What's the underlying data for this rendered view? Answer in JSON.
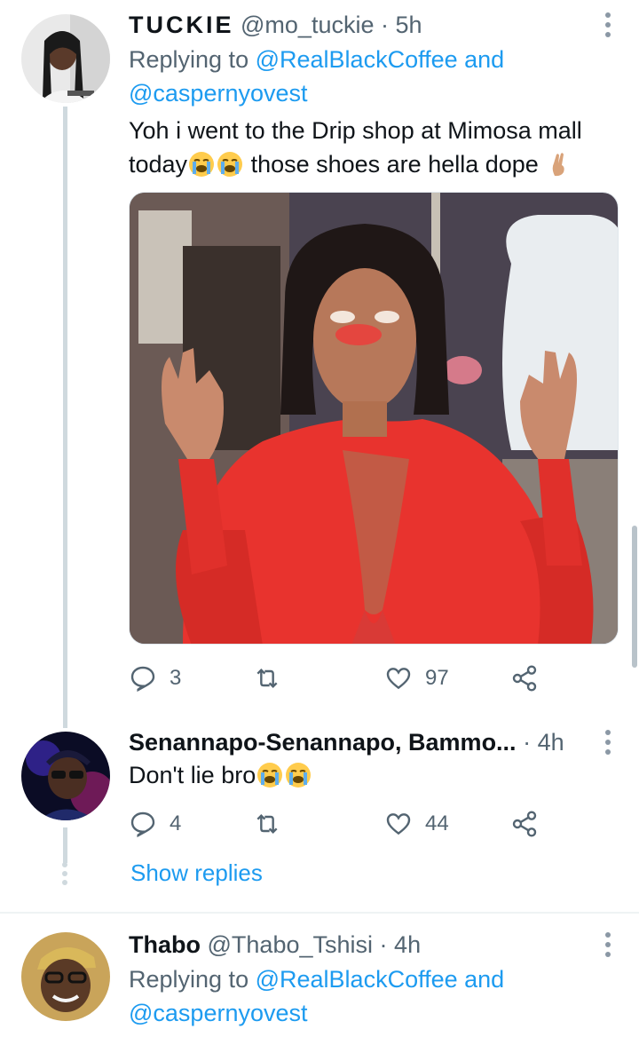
{
  "tweets": [
    {
      "name": "TUCKIE",
      "handle": "@mo_tuckie",
      "separator": "·",
      "time": "5h",
      "replying_prefix": "Replying to",
      "replying_users": "@RealBlackCoffee and @caspernyovest",
      "text_line1": "Yoh i went to the Drip shop at Mimosa mall",
      "text_line2_a": "today",
      "text_line2_b": " those shoes are hella dope",
      "emojis": [
        "loudly-crying-face",
        "loudly-crying-face",
        "crossed-fingers"
      ],
      "media_alt": "Woman in red lace dress making OK hand gestures",
      "stats": {
        "replies": "3",
        "retweets": "",
        "likes": "97"
      }
    },
    {
      "name": "Senannapo-Senannapo, Bammo...",
      "separator": "·",
      "time": "4h",
      "text": "Don't lie bro",
      "emojis": [
        "loudly-crying-face",
        "loudly-crying-face"
      ],
      "stats": {
        "replies": "4",
        "retweets": "",
        "likes": "44"
      }
    },
    {
      "name": "Thabo",
      "handle": "@Thabo_Tshisi",
      "separator": "·",
      "time": "4h",
      "replying_prefix": "Replying to",
      "replying_users": "@RealBlackCoffee and @caspernyovest"
    }
  ],
  "show_replies_label": "Show replies",
  "colors": {
    "link": "#1d9bf0",
    "secondary": "#536471",
    "primary": "#0f1419",
    "thread_line": "#cfd9de"
  }
}
